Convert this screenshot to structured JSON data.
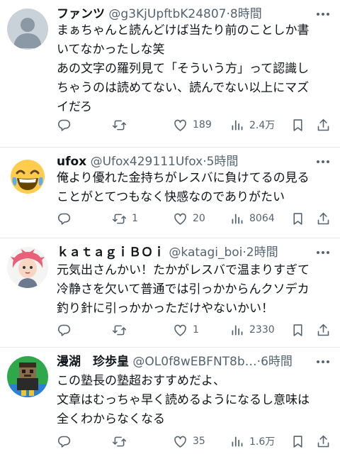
{
  "tweets": [
    {
      "name": "ファンツ",
      "handle": "@g3KjUpftbK24807",
      "time": "8時間",
      "lines": [
        "まぁちゃんと読んどけば当たり前のことしか書",
        "いてなかったしな笑",
        "あの文字の羅列見て「そういう方」って認識し",
        "ちゃうのは読めてない、読んでない以上にマズ",
        "イだろ"
      ],
      "reply_count": "",
      "retweet_count": "",
      "like_count": "189",
      "view_count": "2.4万",
      "avatar_icon": "default-avatar-icon"
    },
    {
      "name": "ufox",
      "handle": "@Ufox429111Ufox",
      "time": "5時間",
      "lines": [
        "俺より優れた金持ちがレスバに負けてるの見る",
        "ことがとてつもなく快感なのでありがたい"
      ],
      "reply_count": "",
      "retweet_count": "1",
      "like_count": "20",
      "view_count": "8064",
      "avatar_icon": "laughing-emoji-avatar-icon"
    },
    {
      "name": "ｋａｔａｇｉＢＯｉ",
      "handle": "@katagi_boi",
      "time": "2時間",
      "lines": [
        "元気出さんかい！たかがレスバで温まりすぎて",
        "冷静さを欠いて普通では引っかからんクソデカ",
        "釣り針に引っかかっただけやないかい！"
      ],
      "reply_count": "",
      "retweet_count": "",
      "like_count": "1",
      "view_count": "2330",
      "avatar_icon": "anime-character-avatar-icon"
    },
    {
      "name": "漫湖　珍歩皇",
      "handle": "@OL0f8wEBFNT8b…",
      "time": "6時間",
      "lines": [
        "この塾長の塾超おすすめだよ、",
        "文章はむっちゃ早く読めるようになるし意味は",
        "全くわからなくなる"
      ],
      "reply_count": "",
      "retweet_count": "",
      "like_count": "35",
      "view_count": "1.6万",
      "avatar_icon": "game-character-avatar-icon"
    }
  ],
  "colors": {
    "text": "#0f1419",
    "secondary": "#536471",
    "divider": "#e6e9ea"
  },
  "icons": [
    "more-icon",
    "reply-icon",
    "retweet-icon",
    "like-icon",
    "views-icon",
    "bookmark-icon",
    "share-icon"
  ]
}
